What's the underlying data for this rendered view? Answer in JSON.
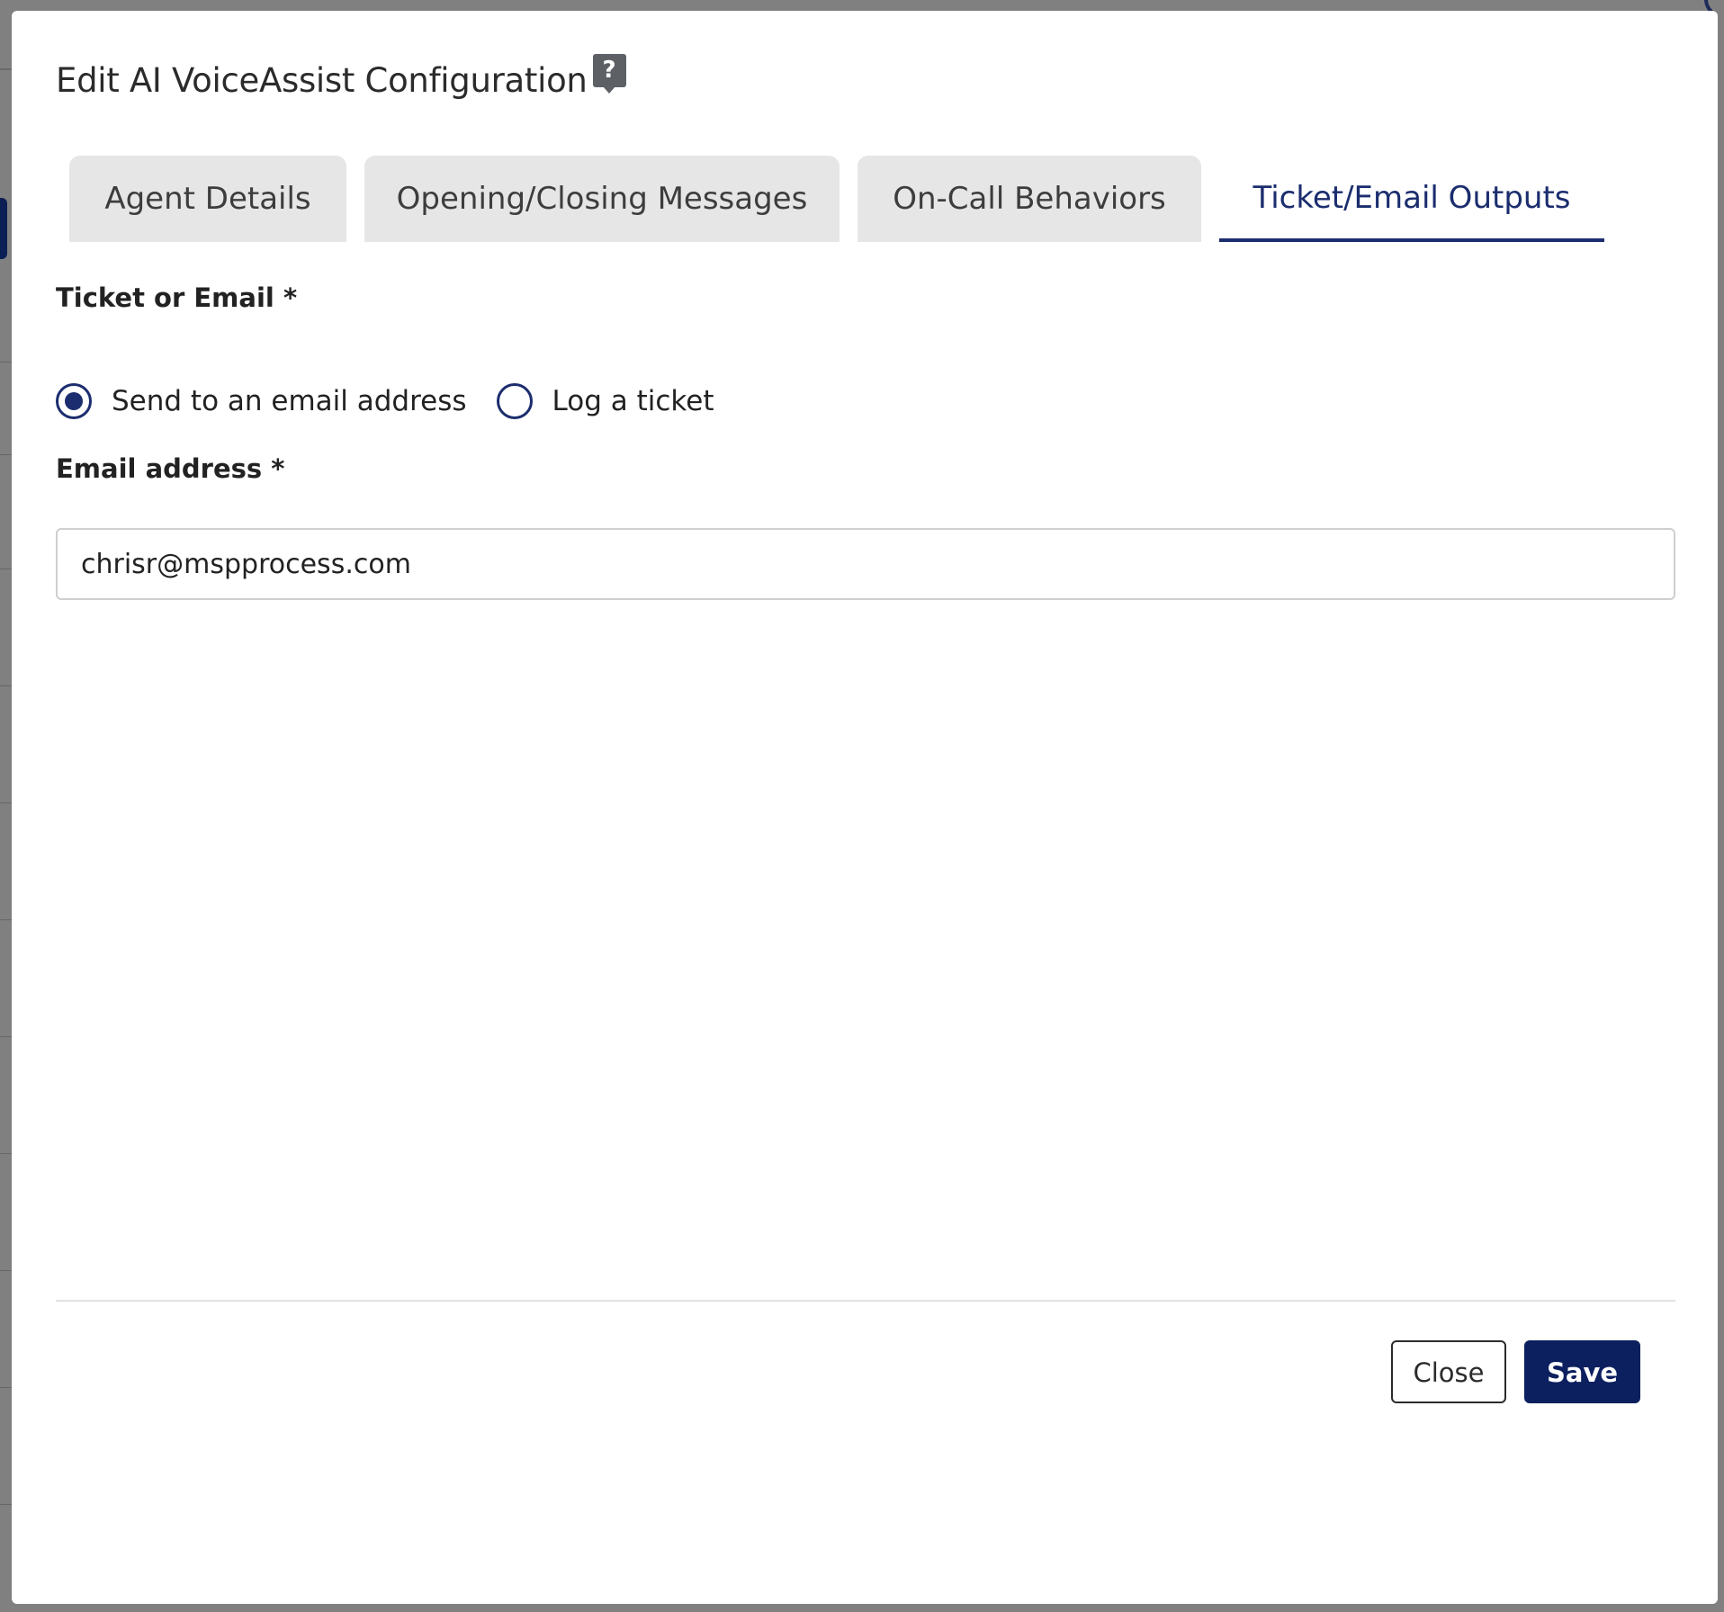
{
  "dialog": {
    "title": "Edit AI VoiceAssist Configuration",
    "help_icon": "help-question-icon"
  },
  "tabs": [
    {
      "label": "Agent Details",
      "active": false
    },
    {
      "label": "Opening/Closing Messages",
      "active": false
    },
    {
      "label": "On-Call Behaviors",
      "active": false
    },
    {
      "label": "Ticket/Email Outputs",
      "active": true
    }
  ],
  "form": {
    "ticket_or_email": {
      "label": "Ticket or Email *",
      "options": [
        {
          "label": "Send to an email address",
          "checked": true
        },
        {
          "label": "Log a ticket",
          "checked": false
        }
      ]
    },
    "email_address": {
      "label": "Email address *",
      "value": "chrisr@mspprocess.com"
    }
  },
  "footer": {
    "close_label": "Close",
    "save_label": "Save"
  },
  "colors": {
    "accent": "#1b2d6e",
    "primary_button": "#0c1f5e",
    "overlay": "#808080"
  }
}
